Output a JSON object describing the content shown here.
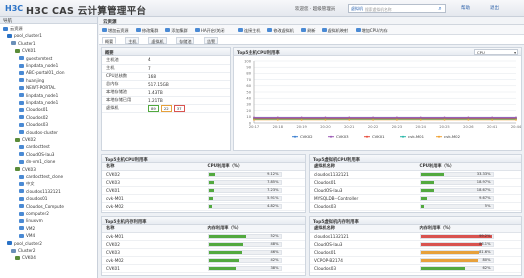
{
  "app": {
    "logo": "H3C",
    "title": "H3C CAS 云计算管理平台",
    "welcome": "欢迎您 · 超级管理员",
    "search_selector": "虚拟机",
    "search_placeholder": "搜索虚拟机名称",
    "menu": [
      "帮助",
      "退出"
    ]
  },
  "sidebar": {
    "header": "导航",
    "tree": [
      {
        "label": "云资源",
        "level": 0,
        "icon": "cloud-icon"
      },
      {
        "label": "pool_cluster1",
        "level": 1,
        "icon": "pool-icon"
      },
      {
        "label": "Cluster1",
        "level": 2,
        "icon": "cluster-icon"
      },
      {
        "label": "CVK01",
        "level": 3,
        "icon": "host-icon"
      },
      {
        "label": "guestvmtest",
        "level": 4,
        "icon": "vm-icon"
      },
      {
        "label": "linpdata_node1",
        "level": 4,
        "icon": "vm-icon"
      },
      {
        "label": "ABC-portal01_clon",
        "level": 4,
        "icon": "vm-icon"
      },
      {
        "label": "huanjing",
        "level": 4,
        "icon": "vm-icon"
      },
      {
        "label": "NEWT-PORTAL",
        "level": 4,
        "icon": "vm-icon"
      },
      {
        "label": "linpdata_node1",
        "level": 4,
        "icon": "vm-icon"
      },
      {
        "label": "linpdata_node1",
        "level": 4,
        "icon": "vm-icon"
      },
      {
        "label": "Cloudos01",
        "level": 4,
        "icon": "vm-icon"
      },
      {
        "label": "Cloudos02",
        "level": 4,
        "icon": "vm-icon"
      },
      {
        "label": "Cloudos03",
        "level": 4,
        "icon": "vm-icon"
      },
      {
        "label": "cloudos-cluster",
        "level": 4,
        "icon": "vm-icon"
      },
      {
        "label": "CVK02",
        "level": 3,
        "icon": "host-icon"
      },
      {
        "label": "cardocttest",
        "level": 4,
        "icon": "vm-icon"
      },
      {
        "label": "CloudOS-lau3",
        "level": 4,
        "icon": "vm-icon"
      },
      {
        "label": "dn-vm1_clone",
        "level": 4,
        "icon": "vm-icon"
      },
      {
        "label": "CVK03",
        "level": 3,
        "icon": "host-icon"
      },
      {
        "label": "cardocttest_clone",
        "level": 4,
        "icon": "vm-icon"
      },
      {
        "label": "中文",
        "level": 4,
        "icon": "vm-icon"
      },
      {
        "label": "cloudos1132121",
        "level": 4,
        "icon": "vm-icon"
      },
      {
        "label": "cloudos01",
        "level": 4,
        "icon": "vm-icon"
      },
      {
        "label": "Cloudos_Compute",
        "level": 4,
        "icon": "vm-icon"
      },
      {
        "label": "computer2",
        "level": 4,
        "icon": "vm-icon"
      },
      {
        "label": "linuxvm",
        "level": 4,
        "icon": "vm-icon"
      },
      {
        "label": "VM2",
        "level": 4,
        "icon": "vm-icon"
      },
      {
        "label": "VM4",
        "level": 4,
        "icon": "vm-icon"
      },
      {
        "label": "pool_cluster2",
        "level": 1,
        "icon": "pool-icon"
      },
      {
        "label": "Cluster2",
        "level": 2,
        "icon": "cluster-icon"
      },
      {
        "label": "CVK04",
        "level": 3,
        "icon": "host-icon"
      }
    ]
  },
  "main": {
    "header": "云资源",
    "toolbar": [
      "增加云资源",
      "修改集群",
      "添加集群",
      "HA开启/关闭",
      "连接主机",
      "修改虚拟机",
      "刷新",
      "虚拟机映射",
      "增加CPU/内存"
    ],
    "tabs": [
      "概要",
      "主机",
      "虚拟机",
      "存储池",
      "告警"
    ]
  },
  "summary": {
    "title": "概要",
    "rows": [
      {
        "k": "主机池",
        "v": "4"
      },
      {
        "k": "主机",
        "v": "7"
      },
      {
        "k": "CPU总核数",
        "v": "168"
      },
      {
        "k": "总内存",
        "v": "517.15GB"
      },
      {
        "k": "本地存储池",
        "v": "1.43TB"
      },
      {
        "k": "本地存储已用",
        "v": "1.21TB"
      },
      {
        "k": "虚拟机",
        "v": ""
      }
    ],
    "vm_badges": [
      "89",
      "22",
      "37"
    ],
    "status_colors": {
      "running": "#53a93f",
      "paused": "#e7a13b",
      "stopped": "#d9534f"
    }
  },
  "cpu_chart": {
    "title": "Top5主机CPU利用率",
    "selector": "CPU",
    "chart_data": {
      "type": "line",
      "title": "Top5主机CPU利用率",
      "xlabel": "",
      "ylabel": "",
      "ylim": [
        0,
        100
      ],
      "yticks": [
        0,
        10,
        20,
        30,
        40,
        50,
        60,
        70,
        80,
        90,
        100
      ],
      "categories": [
        "20:17",
        "20:18",
        "20:19",
        "20:20",
        "20:21",
        "20:22",
        "20:23",
        "20:24",
        "20:25",
        "20:26",
        "20:41",
        "20:44"
      ],
      "series": [
        {
          "name": "CVK02",
          "color": "#3b7fd0",
          "values": [
            8,
            8,
            8,
            8,
            8,
            8,
            8,
            8,
            8,
            8,
            8,
            8
          ]
        },
        {
          "name": "CVK03",
          "color": "#9b59b6",
          "values": [
            9,
            9,
            9,
            9,
            9,
            9,
            9,
            9,
            9,
            9,
            9,
            9
          ]
        },
        {
          "name": "CVK01",
          "color": "#e74c3c",
          "values": [
            7,
            7,
            7,
            7,
            7,
            7,
            7,
            7,
            7,
            7,
            7,
            7
          ]
        },
        {
          "name": "cvk-M01",
          "color": "#2ab7a9",
          "values": [
            6,
            6,
            6,
            6,
            6,
            6,
            6,
            6,
            6,
            6,
            6,
            6
          ]
        },
        {
          "name": "cvk-M02",
          "color": "#f0a030",
          "values": [
            5,
            5,
            5,
            5,
            5,
            5,
            5,
            5,
            5,
            5,
            5,
            5
          ]
        }
      ],
      "grid": true,
      "legend": "bottom"
    }
  },
  "host_cpu": {
    "title": "Top5主机CPU利用率",
    "cols": [
      "名称",
      "CPU利用率（%）"
    ],
    "rows": [
      {
        "name": "CVK02",
        "pct": 9.12,
        "label": "9.12%",
        "color": "#53a93f"
      },
      {
        "name": "CVK03",
        "pct": 7.85,
        "label": "7.85%",
        "color": "#53a93f"
      },
      {
        "name": "CVK01",
        "pct": 7.23,
        "label": "7.23%",
        "color": "#53a93f"
      },
      {
        "name": "cvk-M01",
        "pct": 5.91,
        "label": "5.91%",
        "color": "#53a93f"
      },
      {
        "name": "cvk-M02",
        "pct": 4.82,
        "label": "4.82%",
        "color": "#53a93f"
      }
    ]
  },
  "vm_cpu": {
    "title": "Top5虚拟机CPU利用率",
    "cols": [
      "虚拟机名称",
      "CPU利用率（%）"
    ],
    "rows": [
      {
        "name": "cloudos1132121",
        "pct": 33.33,
        "label": "33.33%",
        "color": "#53a93f"
      },
      {
        "name": "Cloudos01",
        "pct": 18.97,
        "label": "18.97%",
        "color": "#53a93f"
      },
      {
        "name": "CloudOS-lau3",
        "pct": 18.67,
        "label": "18.67%",
        "color": "#53a93f"
      },
      {
        "name": "MYSQLDB--Controller",
        "pct": 9.67,
        "label": "9.67%",
        "color": "#53a93f"
      },
      {
        "name": "Cloudos03",
        "pct": 5.0,
        "label": "5%",
        "color": "#53a93f"
      }
    ]
  },
  "host_mem": {
    "title": "Top5主机内存利用率",
    "cols": [
      "名称",
      "内存利用率（%）"
    ],
    "rows": [
      {
        "name": "cvk-M01",
        "pct": 52.0,
        "label": "52%",
        "color": "#53a93f"
      },
      {
        "name": "CVK02",
        "pct": 48.0,
        "label": "48%",
        "color": "#53a93f"
      },
      {
        "name": "CVK03",
        "pct": 46.0,
        "label": "46%",
        "color": "#53a93f"
      },
      {
        "name": "cvk-M02",
        "pct": 42.0,
        "label": "42%",
        "color": "#53a93f"
      },
      {
        "name": "CVK01",
        "pct": 38.0,
        "label": "38%",
        "color": "#53a93f"
      }
    ]
  },
  "vm_mem": {
    "title": "Top5虚拟机内存利用率",
    "cols": [
      "虚拟机名称",
      "内存利用率（%）"
    ],
    "rows": [
      {
        "name": "cloudos1132121",
        "pct": 99.2,
        "label": "99.2%",
        "color": "#d9534f"
      },
      {
        "name": "CloudOS-lau3",
        "pct": 86.1,
        "label": "86.1%",
        "color": "#d9534f"
      },
      {
        "name": "Cloudos01",
        "pct": 81.6,
        "label": "81.6%",
        "color": "#e7a13b"
      },
      {
        "name": "VCPOP-B2174",
        "pct": 80.0,
        "label": "80%",
        "color": "#e7a13b"
      },
      {
        "name": "Cloudos03",
        "pct": 62.0,
        "label": "62%",
        "color": "#53a93f"
      }
    ]
  }
}
